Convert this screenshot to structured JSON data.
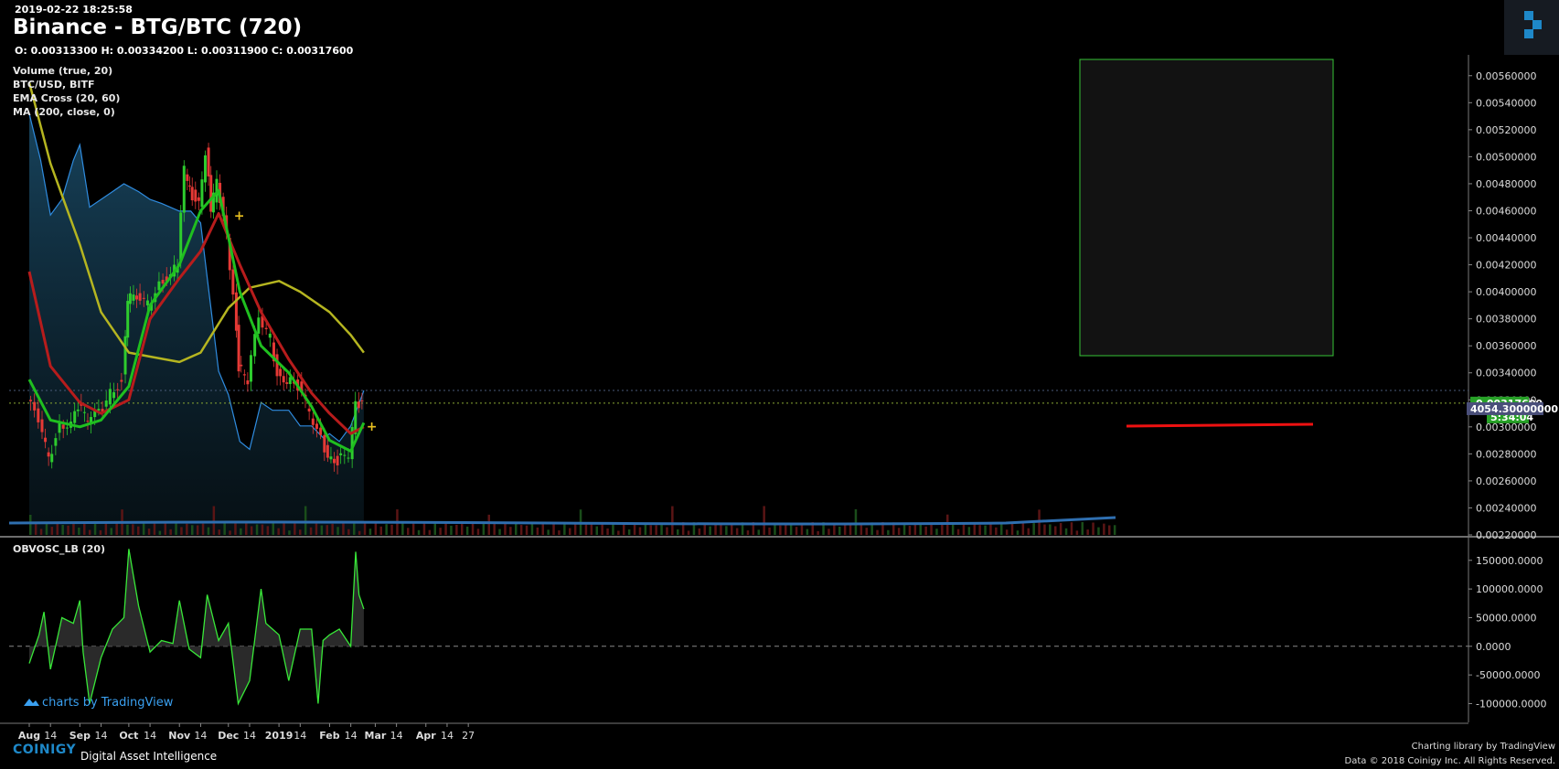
{
  "header": {
    "timestamp": "2019-02-22 18:25:58",
    "title": "Binance - BTG/BTC (720)",
    "ohlc": "O: 0.00313300 H: 0.00334200 L: 0.00311900 C: 0.00317600"
  },
  "indicators": [
    "Volume (true, 20)",
    "BTC/USD, BITF",
    "EMA Cross (20, 60)",
    "MA (200, close, 0)"
  ],
  "oscillator_label": "OBVOSC_LB (20)",
  "footer": {
    "brand": "COINIGY",
    "brand_sub": "Digital Asset Intelligence",
    "tv_text": "charts by TradingView",
    "credit_line1": "Charting library by  TradingView",
    "credit_line2": "Data © 2018  Coinigy Inc. All Rights Reserved."
  },
  "colors": {
    "background": "#000000",
    "candle_up": "#2ecc2e",
    "candle_down": "#e53935",
    "ema_fast": "#1fbf1f",
    "ema_slow": "#b71c1c",
    "ma200": "#b5b520",
    "btcusd": "#2f8ce0",
    "oscillator": "#38e838",
    "price_tag": "#27a127",
    "btc_tag": "#4a4f7a",
    "box": "#36c436"
  },
  "chart_data": [
    {
      "type": "line",
      "title": "Binance - BTG/BTC (720)",
      "x_ticks": [
        "Aug",
        "14",
        "Sep",
        "14",
        "Oct",
        "14",
        "Nov",
        "14",
        "Dec",
        "14",
        "2019",
        "14",
        "Feb",
        "14",
        "Mar",
        "14",
        "Apr",
        "14",
        "27"
      ],
      "y_ticks": [
        "0.00560000",
        "0.00540000",
        "0.00520000",
        "0.00500000",
        "0.00480000",
        "0.00460000",
        "0.00440000",
        "0.00420000",
        "0.00400000",
        "0.00380000",
        "0.00360000",
        "0.00340000",
        "0.00320000",
        "0.00300000",
        "0.00280000",
        "0.00260000",
        "0.00240000",
        "0.00220000"
      ],
      "ylim": [
        0.0022,
        0.0057
      ],
      "price_label": "0.00317600",
      "countdown_label": "5:34:04",
      "btc_label": "4054.30000000",
      "series": [
        {
          "name": "BTG/BTC",
          "x": [
            "Aug 1",
            "Aug 8",
            "Aug 14",
            "Aug 21",
            "Aug 28",
            "Sep 1",
            "Sep 7",
            "Sep 14",
            "Sep 21",
            "Sep 28",
            "Oct 1",
            "Oct 7",
            "Oct 14",
            "Oct 21",
            "Oct 28",
            "Nov 1",
            "Nov 5",
            "Nov 8",
            "Nov 14",
            "Nov 18",
            "Nov 21",
            "Nov 25",
            "Dec 1",
            "Dec 5",
            "Dec 8",
            "Dec 14",
            "Dec 21",
            "Dec 28",
            "Jan 1",
            "Jan 7",
            "Jan 14",
            "Jan 21",
            "Jan 28",
            "Feb 1",
            "Feb 7",
            "Feb 14",
            "Feb 18",
            "Feb 22"
          ],
          "values": [
            0.0032,
            0.00305,
            0.00275,
            0.003,
            0.00305,
            0.00315,
            0.00305,
            0.0031,
            0.00325,
            0.00335,
            0.00395,
            0.00395,
            0.0039,
            0.00405,
            0.00415,
            0.0042,
            0.0049,
            0.00475,
            0.00465,
            0.00505,
            0.0046,
            0.0048,
            0.0044,
            0.004,
            0.00345,
            0.00335,
            0.0038,
            0.00365,
            0.0034,
            0.00335,
            0.0033,
            0.0031,
            0.0029,
            0.0028,
            0.00275,
            0.0028,
            0.00315,
            0.003176
          ]
        },
        {
          "name": "EMA 20",
          "x": [
            "Aug 1",
            "Aug 14",
            "Sep 1",
            "Sep 14",
            "Oct 1",
            "Oct 14",
            "Nov 1",
            "Nov 14",
            "Nov 25",
            "Dec 8",
            "Dec 21",
            "Jan 7",
            "Jan 21",
            "Feb 1",
            "Feb 14",
            "Feb 22"
          ],
          "values": [
            0.00335,
            0.00305,
            0.003,
            0.00305,
            0.0033,
            0.0039,
            0.0042,
            0.0046,
            0.00475,
            0.004,
            0.0036,
            0.0034,
            0.00315,
            0.0029,
            0.00282,
            0.00303
          ]
        },
        {
          "name": "EMA 60",
          "x": [
            "Aug 1",
            "Aug 14",
            "Sep 1",
            "Sep 14",
            "Oct 1",
            "Oct 14",
            "Nov 1",
            "Nov 14",
            "Nov 25",
            "Dec 8",
            "Dec 21",
            "Jan 7",
            "Jan 21",
            "Feb 1",
            "Feb 14",
            "Feb 22"
          ],
          "values": [
            0.00415,
            0.00345,
            0.00318,
            0.0031,
            0.0032,
            0.0038,
            0.0041,
            0.0043,
            0.00458,
            0.0042,
            0.00385,
            0.0035,
            0.00325,
            0.0031,
            0.00295,
            0.003
          ]
        },
        {
          "name": "MA 200",
          "x": [
            "Aug 1",
            "Aug 14",
            "Sep 1",
            "Sep 14",
            "Oct 1",
            "Oct 14",
            "Nov 1",
            "Nov 14",
            "Dec 1",
            "Dec 14",
            "Jan 1",
            "Jan 14",
            "Feb 1",
            "Feb 14",
            "Feb 22"
          ],
          "values": [
            0.00555,
            0.00495,
            0.00435,
            0.00385,
            0.00355,
            0.00352,
            0.00348,
            0.00355,
            0.00388,
            0.00403,
            0.00408,
            0.004,
            0.00385,
            0.00368,
            0.00355
          ]
        },
        {
          "name": "BTC/USD",
          "x": [
            "Aug 1",
            "Aug 8",
            "Aug 14",
            "Aug 21",
            "Aug 28",
            "Sep 1",
            "Sep 7",
            "Sep 14",
            "Sep 21",
            "Sep 28",
            "Oct 7",
            "Oct 14",
            "Oct 21",
            "Nov 1",
            "Nov 8",
            "Nov 14",
            "Nov 18",
            "Nov 25",
            "Dec 1",
            "Dec 8",
            "Dec 14",
            "Dec 21",
            "Dec 28",
            "Jan 7",
            "Jan 14",
            "Jan 21",
            "Jan 28",
            "Feb 1",
            "Feb 7",
            "Feb 14",
            "Feb 22"
          ],
          "values": [
            7600,
            7000,
            6300,
            6500,
            7000,
            7200,
            6400,
            6500,
            6600,
            6700,
            6600,
            6500,
            6450,
            6350,
            6350,
            6200,
            5500,
            4300,
            4000,
            3400,
            3300,
            3900,
            3800,
            3800,
            3600,
            3600,
            3450,
            3500,
            3400,
            3600,
            4054.3
          ]
        }
      ]
    },
    {
      "type": "area",
      "title": "OBVOSC_LB (20)",
      "y_ticks": [
        "150000.0000",
        "100000.0000",
        "50000.0000",
        "0.0000",
        "-50000.0000",
        "-100000.0000"
      ],
      "ylim": [
        -120000,
        180000
      ],
      "series": [
        {
          "name": "OBVOSC_LB (20)",
          "x": [
            "Aug 1",
            "Aug 7",
            "Aug 10",
            "Aug 14",
            "Aug 21",
            "Aug 28",
            "Sep 1",
            "Sep 3",
            "Sep 7",
            "Sep 14",
            "Sep 21",
            "Sep 28",
            "Oct 1",
            "Oct 7",
            "Oct 14",
            "Oct 21",
            "Oct 28",
            "Nov 1",
            "Nov 7",
            "Nov 14",
            "Nov 18",
            "Nov 25",
            "Dec 1",
            "Dec 7",
            "Dec 14",
            "Dec 21",
            "Dec 24",
            "Dec 28",
            "Jan 1",
            "Jan 7",
            "Jan 14",
            "Jan 21",
            "Jan 25",
            "Jan 28",
            "Feb 1",
            "Feb 7",
            "Feb 14",
            "Feb 17",
            "Feb 19",
            "Feb 22"
          ],
          "values": [
            -30000,
            20000,
            60000,
            -40000,
            50000,
            40000,
            80000,
            -10000,
            -100000,
            -20000,
            30000,
            50000,
            170000,
            70000,
            -10000,
            10000,
            5000,
            80000,
            -5000,
            -20000,
            90000,
            10000,
            40000,
            -100000,
            -60000,
            100000,
            40000,
            30000,
            20000,
            -60000,
            30000,
            30000,
            -100000,
            10000,
            20000,
            30000,
            0,
            165000,
            90000,
            65000
          ]
        }
      ]
    }
  ]
}
